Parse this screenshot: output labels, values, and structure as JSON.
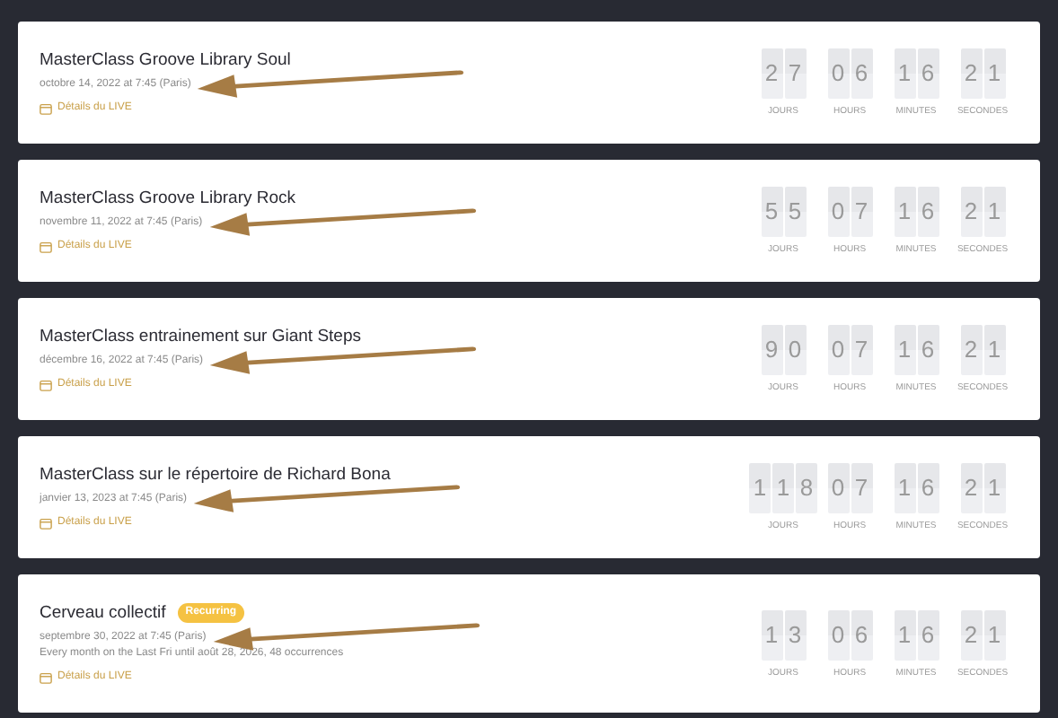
{
  "events": [
    {
      "title": "MasterClass Groove Library Soul",
      "date": "octobre 14, 2022 at 7:45 (Paris)",
      "details": "Détails du LIVE",
      "countdown": [
        {
          "digits": [
            "2",
            "7"
          ],
          "label": "JOURS"
        },
        {
          "digits": [
            "0",
            "6"
          ],
          "label": "HOURS"
        },
        {
          "digits": [
            "1",
            "6"
          ],
          "label": "MINUTES"
        },
        {
          "digits": [
            "2",
            "1"
          ],
          "label": "SECONDES"
        }
      ]
    },
    {
      "title": "MasterClass Groove Library Rock",
      "date": "novembre 11, 2022 at 7:45 (Paris)",
      "details": "Détails du LIVE",
      "countdown": [
        {
          "digits": [
            "5",
            "5"
          ],
          "label": "JOURS"
        },
        {
          "digits": [
            "0",
            "7"
          ],
          "label": "HOURS"
        },
        {
          "digits": [
            "1",
            "6"
          ],
          "label": "MINUTES"
        },
        {
          "digits": [
            "2",
            "1"
          ],
          "label": "SECONDES"
        }
      ]
    },
    {
      "title": "MasterClass entrainement sur Giant Steps",
      "date": "décembre 16, 2022 at 7:45 (Paris)",
      "details": "Détails du LIVE",
      "countdown": [
        {
          "digits": [
            "9",
            "0"
          ],
          "label": "JOURS"
        },
        {
          "digits": [
            "0",
            "7"
          ],
          "label": "HOURS"
        },
        {
          "digits": [
            "1",
            "6"
          ],
          "label": "MINUTES"
        },
        {
          "digits": [
            "2",
            "1"
          ],
          "label": "SECONDES"
        }
      ]
    },
    {
      "title": "MasterClass sur le répertoire de Richard Bona",
      "date": "janvier 13, 2023 at 7:45 (Paris)",
      "details": "Détails du LIVE",
      "countdown": [
        {
          "digits": [
            "1",
            "1",
            "8"
          ],
          "label": "JOURS"
        },
        {
          "digits": [
            "0",
            "7"
          ],
          "label": "HOURS"
        },
        {
          "digits": [
            "1",
            "6"
          ],
          "label": "MINUTES"
        },
        {
          "digits": [
            "2",
            "1"
          ],
          "label": "SECONDES"
        }
      ]
    },
    {
      "title": "Cerveau collectif",
      "badge": "Recurring",
      "date": "septembre 30, 2022 at 7:45 (Paris)",
      "recurrence": "Every month on the Last Fri until août 28, 2026, 48 occurrences",
      "details": "Détails du LIVE",
      "countdown": [
        {
          "digits": [
            "1",
            "3"
          ],
          "label": "JOURS"
        },
        {
          "digits": [
            "0",
            "6"
          ],
          "label": "HOURS"
        },
        {
          "digits": [
            "1",
            "6"
          ],
          "label": "MINUTES"
        },
        {
          "digits": [
            "2",
            "1"
          ],
          "label": "SECONDES"
        }
      ]
    }
  ]
}
